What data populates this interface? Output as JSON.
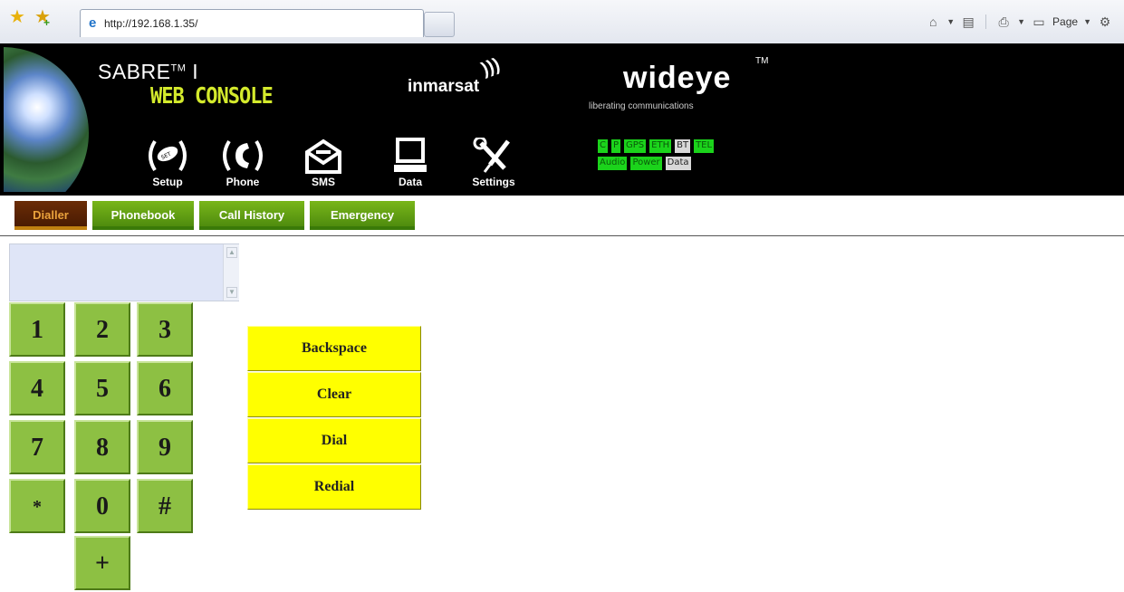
{
  "browser": {
    "address": "http://192.168.1.35/",
    "page_menu_label": "Page",
    "icons": [
      "favorites-star-icon",
      "add-favorites-icon",
      "ie-page-icon",
      "home-icon",
      "feeds-icon",
      "print-icon",
      "page-icon",
      "tools-gear-icon"
    ]
  },
  "header": {
    "product": "SABRE",
    "product_tm": "TM",
    "product_suffix": "I",
    "console": "WEB CONSOLE",
    "partner": "inmarsat",
    "brand": "wideye",
    "brand_tm": "TM",
    "tagline": "liberating communications"
  },
  "nav": [
    {
      "label": "Setup",
      "icon": "setup-icon"
    },
    {
      "label": "Phone",
      "icon": "phone-icon"
    },
    {
      "label": "SMS",
      "icon": "sms-envelope-icon"
    },
    {
      "label": "Data",
      "icon": "computer-monitor-icon"
    },
    {
      "label": "Settings",
      "icon": "wrench-tools-icon"
    }
  ],
  "status": {
    "row1": [
      {
        "label": "C",
        "state": "on"
      },
      {
        "label": "P",
        "state": "on"
      },
      {
        "label": "GPS",
        "state": "on"
      },
      {
        "label": "ETH",
        "state": "on"
      },
      {
        "label": "BT",
        "state": "off"
      },
      {
        "label": "TEL",
        "state": "on"
      }
    ],
    "row2": [
      {
        "label": "Audio",
        "state": "on"
      },
      {
        "label": "Power",
        "state": "on"
      },
      {
        "label": "Data",
        "state": "off"
      }
    ],
    "colors": {
      "on": "#1bd31b",
      "off": "#d8d8d8"
    }
  },
  "tabs": [
    {
      "label": "Dialler",
      "active": true
    },
    {
      "label": "Phonebook",
      "active": false
    },
    {
      "label": "Call History",
      "active": false
    },
    {
      "label": "Emergency",
      "active": false
    }
  ],
  "dialler": {
    "display_value": "",
    "keys": [
      "1",
      "2",
      "3",
      "4",
      "5",
      "6",
      "7",
      "8",
      "9",
      "*",
      "0",
      "#",
      "+"
    ],
    "actions": [
      "Backspace",
      "Clear",
      "Dial",
      "Redial"
    ]
  },
  "colors": {
    "keypad": "#8dc043",
    "action_button": "#ffff00",
    "tab_green": "#5e9c12",
    "tab_active": "#5a2304",
    "console_text": "#d4ea2c"
  }
}
